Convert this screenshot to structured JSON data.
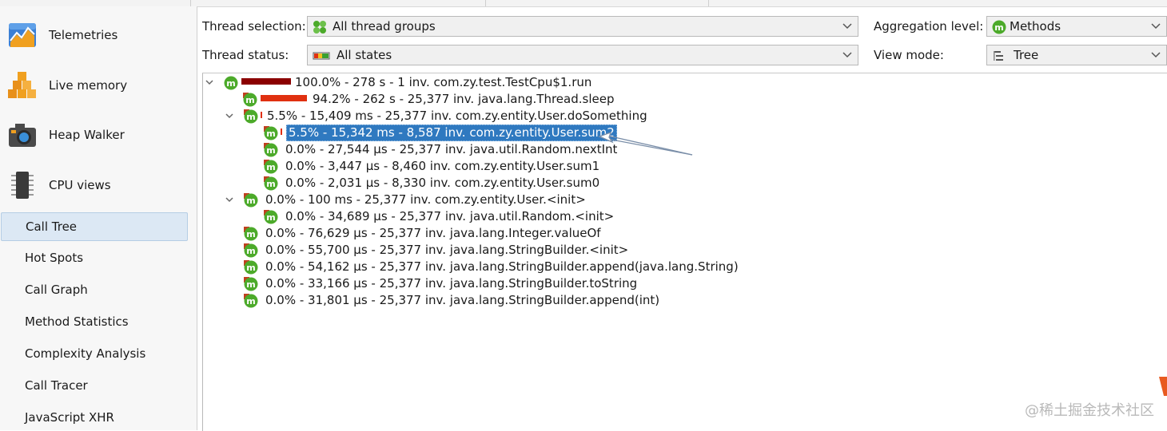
{
  "sidebar": {
    "big_items": [
      {
        "label": "Telemetries",
        "icon": "telemetries-icon"
      },
      {
        "label": "Live memory",
        "icon": "live-memory-icon"
      },
      {
        "label": "Heap Walker",
        "icon": "camera-icon"
      },
      {
        "label": "CPU views",
        "icon": "cpu-chip-icon"
      }
    ],
    "nav_items": [
      {
        "label": "Call Tree",
        "selected": true
      },
      {
        "label": "Hot Spots"
      },
      {
        "label": "Call Graph"
      },
      {
        "label": "Method Statistics"
      },
      {
        "label": "Complexity Analysis"
      },
      {
        "label": "Call Tracer"
      },
      {
        "label": "JavaScript XHR"
      }
    ]
  },
  "controls": {
    "thread_selection": {
      "label": "Thread selection:",
      "value": "All thread groups",
      "icon": "thread-groups-icon"
    },
    "thread_status": {
      "label": "Thread status:",
      "value": "All states",
      "icon": "thread-states-icon"
    },
    "aggregation_level": {
      "label": "Aggregation level:",
      "value": "Methods",
      "icon": "method-icon"
    },
    "view_mode": {
      "label": "View mode:",
      "value": "Tree",
      "icon": "tree-view-icon"
    }
  },
  "tree": {
    "rows": [
      {
        "text": "100.0% - 278 s - 1 inv. com.zy.test.TestCpu$1.run",
        "percent": 100.0,
        "expanded": true
      },
      {
        "text": "94.2% - 262 s - 25,377 inv. java.lang.Thread.sleep",
        "percent": 94.2
      },
      {
        "text": "5.5% - 15,409 ms - 25,377 inv. com.zy.entity.User.doSomething",
        "percent": 5.5,
        "expanded": true
      },
      {
        "text": "5.5% - 15,342 ms - 8,587 inv. com.zy.entity.User.sum2",
        "percent": 5.5,
        "selected": true
      },
      {
        "text": "0.0% - 27,544 µs - 25,377 inv. java.util.Random.nextInt",
        "percent": 0.0
      },
      {
        "text": "0.0% - 3,447 µs - 8,460 inv. com.zy.entity.User.sum1",
        "percent": 0.0
      },
      {
        "text": "0.0% - 2,031 µs - 8,330 inv. com.zy.entity.User.sum0",
        "percent": 0.0
      },
      {
        "text": "0.0% - 100 ms - 25,377 inv. com.zy.entity.User.<init>",
        "percent": 0.0,
        "expanded": true
      },
      {
        "text": "0.0% - 34,689 µs - 25,377 inv. java.util.Random.<init>",
        "percent": 0.0
      },
      {
        "text": "0.0% - 76,629 µs - 25,377 inv. java.lang.Integer.valueOf",
        "percent": 0.0
      },
      {
        "text": "0.0% - 55,700 µs - 25,377 inv. java.lang.StringBuilder.<init>",
        "percent": 0.0
      },
      {
        "text": "0.0% - 54,162 µs - 25,377 inv. java.lang.StringBuilder.append(java.lang.String)",
        "percent": 0.0
      },
      {
        "text": "0.0% - 33,166 µs - 25,377 inv. java.lang.StringBuilder.toString",
        "percent": 0.0
      },
      {
        "text": "0.0% - 31,801 µs - 25,377 inv. java.lang.StringBuilder.append(int)",
        "percent": 0.0
      }
    ]
  },
  "colors": {
    "accent": "#2f79c0",
    "method_green": "#4caa2a",
    "bar_dark": "#8b0000",
    "bar_red": "#e03010"
  },
  "watermark": "@稀土掘金技术社区"
}
